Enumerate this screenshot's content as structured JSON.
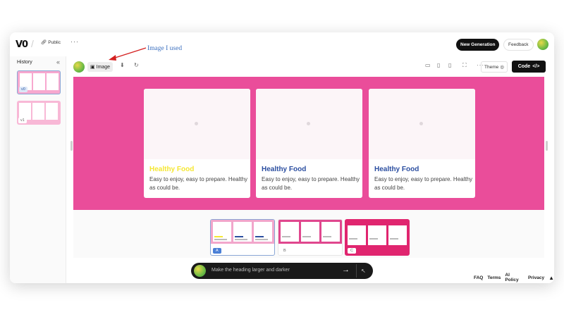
{
  "header": {
    "logo": "V0",
    "visibility_label": "Public",
    "more_label": "···",
    "new_generation_label": "New Generation",
    "feedback_label": "Feedback"
  },
  "annotation": {
    "text": "Image I used",
    "color": "#3b6fbf",
    "arrow_color": "#d42020"
  },
  "sidebar": {
    "title": "History",
    "collapse_icon": "«",
    "items": [
      {
        "label": "v0",
        "active": true
      },
      {
        "label": "v1",
        "active": false
      }
    ]
  },
  "toolbar": {
    "image_label": "Image",
    "theme_label": "Theme",
    "code_label": "Code",
    "code_icon": "</>",
    "icons": [
      "thumbs-down-icon",
      "refresh-icon",
      "desktop-icon",
      "tablet-icon",
      "mobile-icon",
      "fullscreen-icon",
      "more-icon"
    ]
  },
  "preview": {
    "background": "#ea4d9a",
    "cards": [
      {
        "title": "Healthy Food",
        "title_color": "#f5e733",
        "description": "Easy to enjoy, easy to prepare. Healthy as could be."
      },
      {
        "title": "Healthy Food",
        "title_color": "#2b4ea0",
        "description": "Easy to enjoy, easy to prepare. Healthy as could be."
      },
      {
        "title": "Healthy Food",
        "title_color": "#2b4ea0",
        "description": "Easy to enjoy, easy to prepare. Healthy as could be."
      }
    ]
  },
  "variants": [
    {
      "label": "A",
      "band_color": "#f2a6cb",
      "active": true
    },
    {
      "label": "B",
      "band_color": "#e0478e",
      "active": false
    },
    {
      "label": "C",
      "band_color": "#e0256f",
      "active": false
    }
  ],
  "prompt": {
    "placeholder": "Make the heading larger and darker"
  },
  "footer": {
    "links": [
      "FAQ",
      "Terms",
      "AI Policy",
      "Privacy"
    ]
  }
}
